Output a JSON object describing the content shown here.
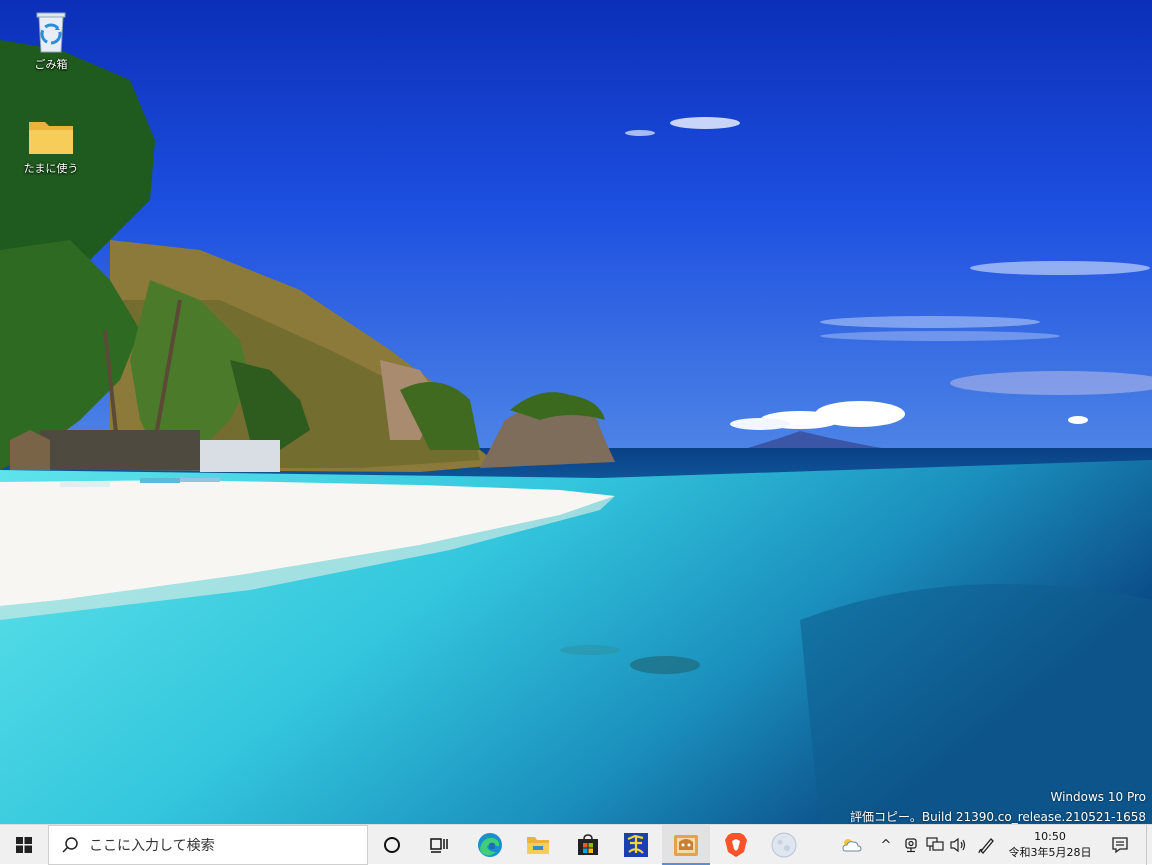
{
  "desktop": {
    "icons": [
      {
        "label": "ごみ箱",
        "icon": "recycle-bin-icon"
      },
      {
        "label": "たまに使う",
        "icon": "folder-icon"
      }
    ],
    "watermark": {
      "line1": "Windows 10 Pro",
      "line2": "評価コピー。Build 21390.co_release.210521-1658"
    }
  },
  "taskbar": {
    "search_placeholder": "ここに入力して検索",
    "pinned_apps": [
      "start-icon",
      "cortana-icon",
      "task-view-icon",
      "edge-icon",
      "file-explorer-icon",
      "store-icon",
      "hidemaru-icon",
      "app-active-icon",
      "brave-icon",
      "moon-icon"
    ],
    "tray": {
      "weather_icon": "weather-cloud-icon",
      "chevron": "^",
      "time": "10:50",
      "date": "令和3年5月28日"
    }
  },
  "colors": {
    "taskbar_bg": "#f0f0f0",
    "accent": "#5a8fd6"
  }
}
